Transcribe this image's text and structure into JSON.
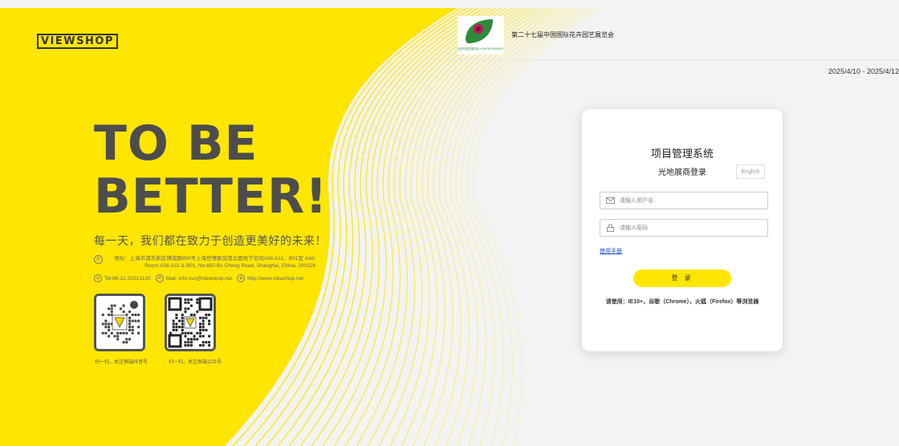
{
  "brand": {
    "name": "VIEWSHOP"
  },
  "hero": {
    "line1": "TO BE",
    "line2": "BETTER!",
    "slogan": "每一天，我们都在致力于创造更美好的未来！",
    "address": "地址：上海市浦东新区博成路850号上海世博展览馆北面地下空间A08-A11、B01室 Add: Room A08-A11 & B01, No.850 Bo Cheng Road, Shanghai, China, 200126",
    "tel": "Tel:86-21-32513130",
    "mail": "Mail: info.vsn@viewshop.net",
    "web": "http://www.viewshop.net"
  },
  "qr": {
    "douyin_caption": "扫一扫，关注恒端抖音号",
    "wechat_caption": "扫一扫，关注恒端公众号"
  },
  "expo": {
    "name": "第二十七届中国国际花卉园艺展览会",
    "logo_text": "中国国际花卉园艺展览会 HORTIFLOREXPO CHINA"
  },
  "date_range": "2025/4/10 - 2025/4/12",
  "login": {
    "title": "项目管理系统",
    "subtitle": "光地展商登录",
    "lang_button": "English",
    "username_placeholder": "请输入用户名",
    "password_placeholder": "请输入密码",
    "manual_link": "使用手册",
    "submit": "登 录",
    "browser_tip": "请使用：IE10+，谷歌（Chrome），火狐（Firefox）等浏览器"
  },
  "colors": {
    "accent": "#ffe600",
    "text": "#4d4d4d"
  }
}
